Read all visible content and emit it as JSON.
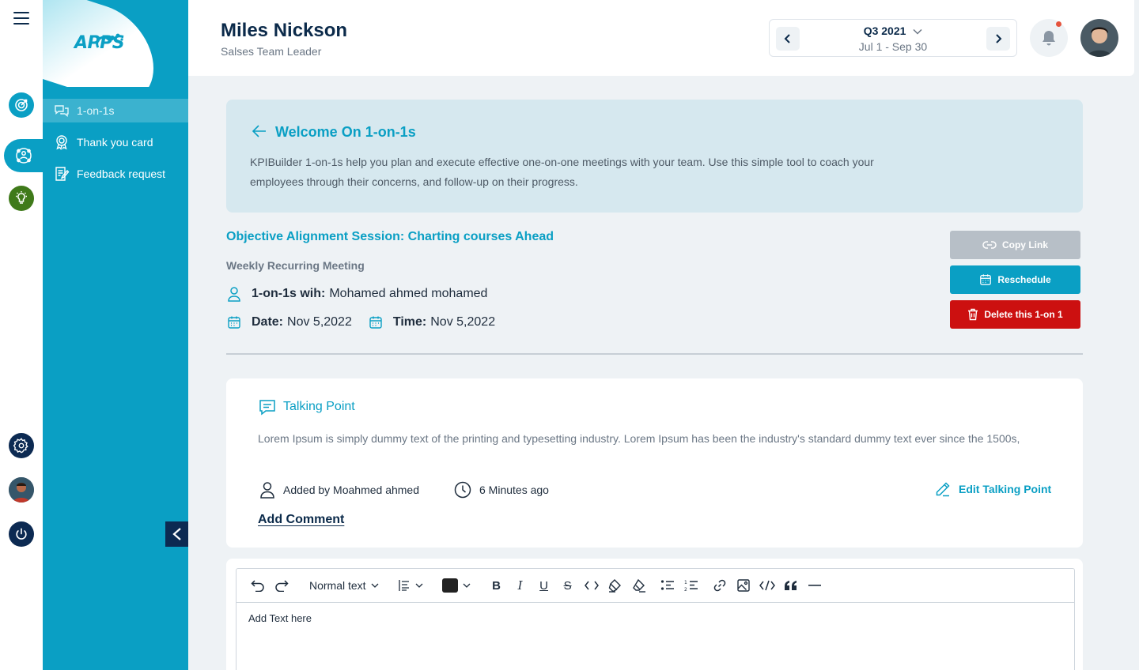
{
  "app": {
    "logo_text": "APPS",
    "accent_color": "#0a9fc4",
    "navy_color": "#0b2a4a"
  },
  "rail": {
    "icons": [
      "menu-icon",
      "target-icon",
      "team-icon",
      "lightbulb-icon",
      "settings-icon",
      "profile-avatar",
      "power-icon"
    ]
  },
  "sidebar": {
    "items": [
      {
        "label": "1-on-1s",
        "icon": "chat-bubbles-icon",
        "active": true
      },
      {
        "label": "Thank you card",
        "icon": "award-icon",
        "active": false
      },
      {
        "label": "Feedback request",
        "icon": "feedback-form-icon",
        "active": false
      }
    ]
  },
  "header": {
    "user_name": "Miles Nickson",
    "user_role": "Salses Team Leader",
    "quarter_label": "Q3 2021",
    "quarter_range": "Jul 1 - Sep 30",
    "notifications_unread": true
  },
  "welcome": {
    "title": "Welcome On 1-on-1s",
    "description": "KPIBuilder 1-on-1s help you plan and execute effective one-on-one meetings with your team. Use this simple tool to coach your employees through their concerns, and follow-up on their progress."
  },
  "meeting": {
    "title": "Objective Alignment Session: Charting courses Ahead",
    "recurrence": "Weekly Recurring Meeting",
    "with_label": "1-on-1s wih:",
    "with_value": "Mohamed ahmed mohamed",
    "date_label": "Date:",
    "date_value": "Nov 5,2022",
    "time_label": "Time:",
    "time_value": "Nov 5,2022"
  },
  "actions": {
    "copy_link": "Copy Link",
    "reschedule": "Reschedule",
    "delete": "Delete this 1-on 1"
  },
  "talking_point": {
    "title": "Talking Point",
    "description": "Lorem Ipsum is simply dummy text of the printing and typesetting industry. Lorem Ipsum has been the industry's standard dummy text ever since the 1500s,",
    "added_by": "Added by Moahmed ahmed",
    "time_ago": "6 Minutes ago",
    "edit_label": "Edit Talking Point",
    "add_comment": "Add Comment"
  },
  "editor": {
    "text_style": "Normal text",
    "placeholder": "Add Text here",
    "text_color": "#222222"
  }
}
